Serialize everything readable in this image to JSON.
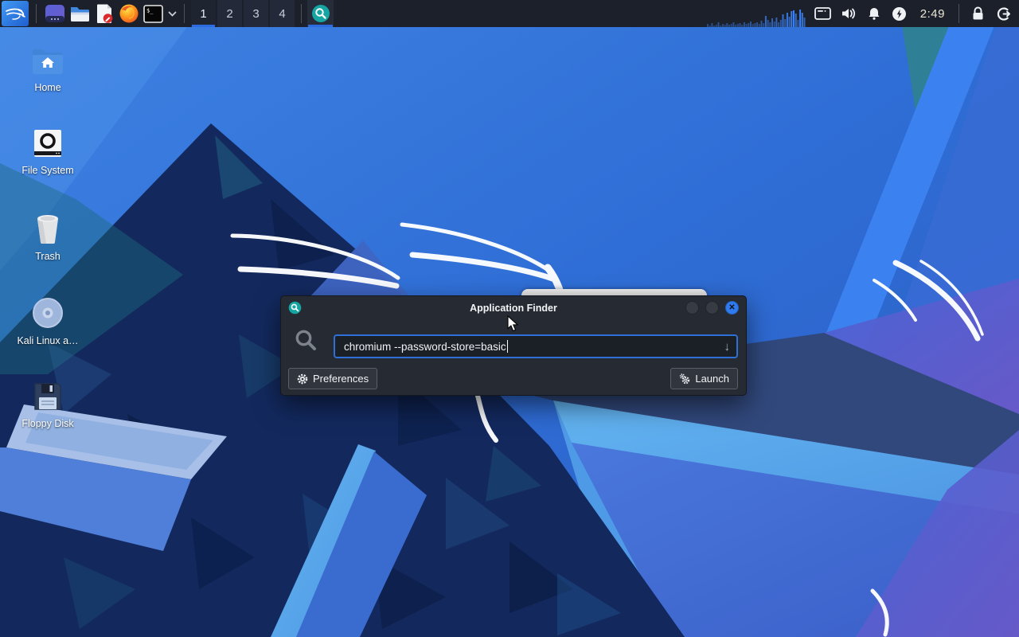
{
  "theme": {
    "accent": "#2d6be0",
    "panel_bg": "#1b202a",
    "dialog_bg": "#262b33",
    "input_border": "#2e70d8",
    "teal": "#16a5a3",
    "close_blue": "#2f7bf0",
    "clock_color": "#ece6d4"
  },
  "panel": {
    "workspaces": [
      "1",
      "2",
      "3",
      "4"
    ],
    "active_workspace": "1",
    "clock": "2:49",
    "cpu_bars": [
      4,
      2,
      5,
      2,
      3,
      6,
      2,
      4,
      3,
      5,
      3,
      4,
      6,
      3,
      4,
      5,
      3,
      6,
      4,
      5,
      7,
      4,
      5,
      6,
      4,
      8,
      5,
      14,
      9,
      6,
      11,
      7,
      12,
      6,
      9,
      16,
      10,
      18,
      13,
      20,
      21,
      17,
      9,
      22,
      18,
      12
    ]
  },
  "desktop": {
    "icons": [
      {
        "label": "Home"
      },
      {
        "label": "File System"
      },
      {
        "label": "Trash"
      },
      {
        "label": "Kali Linux a…"
      },
      {
        "label": "Floppy Disk"
      }
    ]
  },
  "dialog": {
    "title": "Application Finder",
    "search_value": "chromium --password-store=basic",
    "preferences_label": "Preferences",
    "launch_label": "Launch"
  },
  "icons": {
    "dropdown_arrow": "↓",
    "close_glyph": "✕"
  }
}
